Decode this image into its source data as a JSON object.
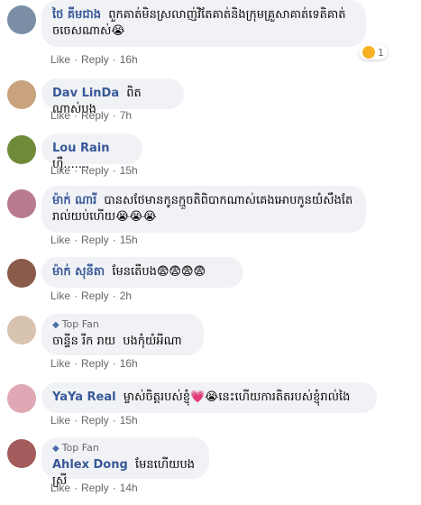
{
  "actions": {
    "like": "Like",
    "reply": "Reply",
    "sep": "·"
  },
  "top_fan_label": "Top Fan",
  "comments": [
    {
      "author": "ថៃ គីមជាង",
      "text": "ពួកគាត់មិនស្រលាញ់វិតែគាត់និងក្រុមគ្រួសាគាត់ទេតិគាត់ចចេសណាស់😭",
      "time": "16h",
      "reactions_count": "1",
      "avatar_color": "#7a8fa6"
    },
    {
      "author": "Dav LinDa",
      "text": "ពិតណាស់បង",
      "time": "7h",
      "avatar_color": "#c9a27e"
    },
    {
      "author": "Lou Rain",
      "text": "ហ៊ឺ.......",
      "time": "15h",
      "avatar_color": "#6f8b3a"
    },
    {
      "author": "ម៉ាក់ ណារី",
      "text": "បានសថែមានកូនក្មួចតិពិបាកណាស់គេងអោបកូនយំសឹងតែរាល់យប់ហើយ😭😭😭",
      "time": "15h",
      "avatar_color": "#b87a8e"
    },
    {
      "author": "ម៉ាក់ សុនីតា",
      "text": "មែនតើបង😨😨😨😨",
      "time": "2h",
      "avatar_color": "#8a5a4a"
    },
    {
      "author": "ចាន្ទីន រីក រាយ",
      "text": "បងកុំយំអីណា",
      "time": "16h",
      "top_fan": true,
      "avatar_color": "#d8c2b0"
    },
    {
      "author": "YaYa Real",
      "text": "ម្ចាស់ចិត្តរបស់ខ្ញុំ💗😭នេះហើយការតិតរបស់ខ្ញុំរាល់ងៃ",
      "time": "15h",
      "avatar_color": "#e0a8b4"
    },
    {
      "author": "Ahlex Dong",
      "text": "មែនហើយបងស្រី",
      "time": "14h",
      "top_fan": true,
      "avatar_color": "#a35b5b"
    }
  ]
}
